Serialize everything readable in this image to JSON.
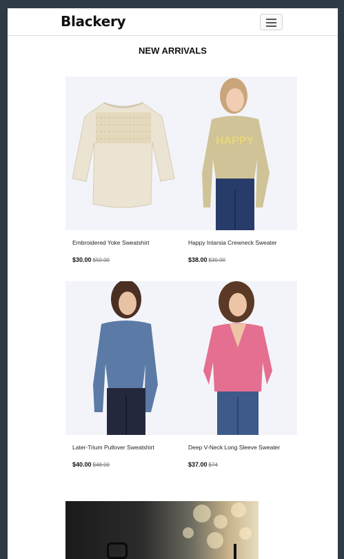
{
  "brand": {
    "name": "Blackery"
  },
  "nav": {
    "toggle_icon": "hamburger-icon"
  },
  "section": {
    "title": "NEW ARRIVALS"
  },
  "products": [
    {
      "name": "Embroidered Yoke Sweatshirt",
      "price": "$30.00",
      "old_price": "$50.00",
      "image": "cream-sweatshirt-image",
      "color": "#ece4d2"
    },
    {
      "name": "Happy Intarsia Crewneck Sweater",
      "price": "$38.00",
      "old_price": "$30.00",
      "image": "happy-sweater-model-image",
      "color": "#cfc397"
    },
    {
      "name": "Later-Trium Pullover Sweatshirt",
      "price": "$40.00",
      "old_price": "$48.00",
      "image": "blue-pullover-model-image",
      "color": "#5b7aa6"
    },
    {
      "name": "Deep V-Neck Long Sleeve Sweater",
      "price": "$37.00",
      "old_price": "$74",
      "image": "pink-sweater-model-image",
      "color": "#e56f90"
    }
  ],
  "colors": {
    "page_bg": "#2e3b47",
    "card_bg": "#f3f4f9"
  }
}
